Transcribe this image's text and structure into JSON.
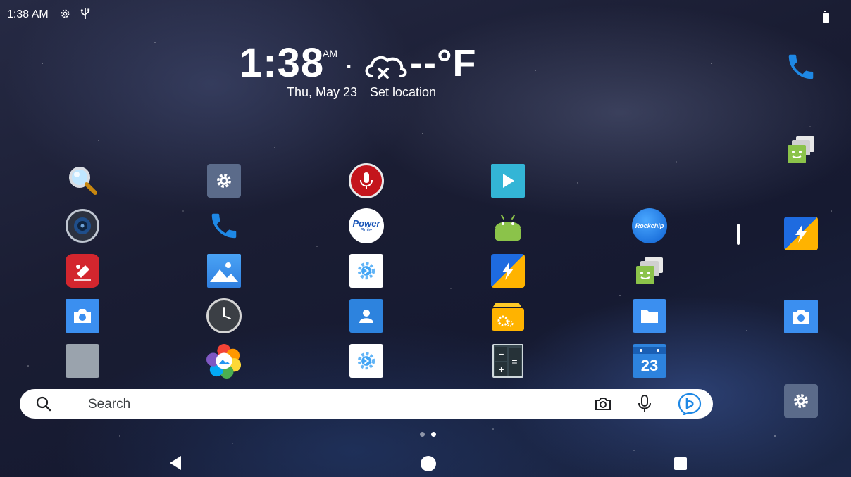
{
  "status_bar": {
    "time": "1:38 AM",
    "icons": [
      "settings-gear-icon",
      "usb-icon",
      "battery-icon"
    ]
  },
  "clock_widget": {
    "time": "1:38",
    "ampm": "AM",
    "separator": "·",
    "weather_icon": "cloud-off-icon",
    "temperature": "--°F",
    "date": "Thu, May 23",
    "location_prompt": "Set location"
  },
  "app_grid": {
    "icons": [
      "magnifier-app-icon",
      "settings-app-icon",
      "voice-recorder-app-icon",
      "play-video-app-icon",
      "speaker-app-icon",
      "phone-app-icon",
      "power-suite-app-icon",
      "android-app-icon",
      "rockchip-app-icon",
      "quectel-app-icon",
      "gallery-app-icon",
      "blue-gear-app-icon",
      "flash-app-icon",
      "messaging-app-icon",
      "camera-app-icon",
      "clock-app-icon",
      "contacts-app-icon",
      "file-settings-app-icon",
      "files-app-icon",
      "office-suite-app-icon",
      "photo-app-icon",
      "blue-gear-app-icon-2",
      "calculator-app-icon",
      "calendar-app-icon"
    ],
    "calendar_day": "23",
    "power_suite_label": "Power",
    "power_suite_sub": "Suite",
    "rockchip_label": "Rockchip"
  },
  "dock": {
    "icons": [
      "phone-icon",
      "messaging-icon",
      "flash-icon",
      "camera-icon",
      "settings-icon"
    ]
  },
  "search_bar": {
    "placeholder": "Search",
    "icons": [
      "search-icon",
      "camera-lens-icon",
      "microphone-icon",
      "bing-icon"
    ]
  },
  "page_indicator": {
    "pages": 2,
    "current": 2
  },
  "nav_bar": {
    "icons": [
      "back-icon",
      "home-icon",
      "recents-icon"
    ]
  }
}
